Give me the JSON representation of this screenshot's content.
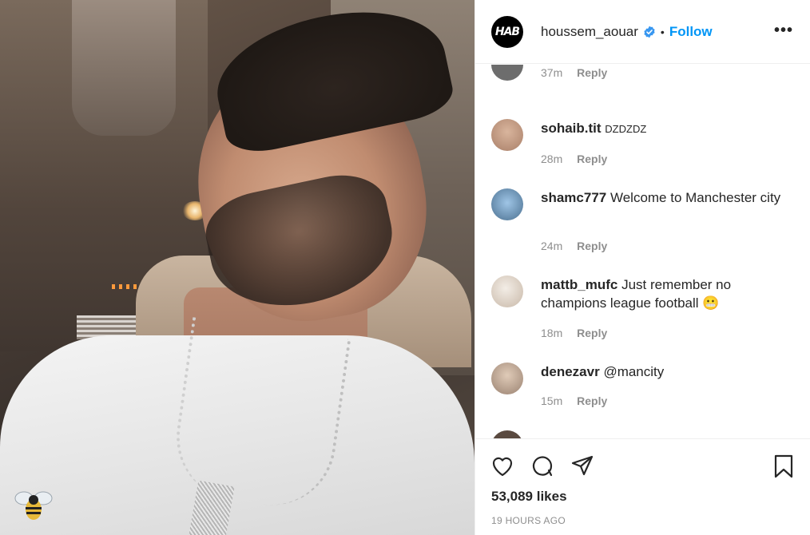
{
  "post": {
    "author": {
      "username": "houssem_aouar",
      "avatar_logo_text": "HAB",
      "verified": true,
      "separator": "•",
      "follow_label": "Follow",
      "more_label": "•••"
    },
    "likes_text": "53,089 likes",
    "time_ago": "19 HOURS AGO"
  },
  "comments": [
    {
      "username": "",
      "text": "",
      "time": "37m",
      "reply_label": "Reply",
      "avatar_color": "#6d6d6d"
    },
    {
      "username": "sohaib.tit",
      "text": "DZDZDZ",
      "time": "28m",
      "reply_label": "Reply",
      "avatar_color": "#c7a28a"
    },
    {
      "username": "shamc777",
      "text": "Welcome to Manchester city",
      "time": "24m",
      "reply_label": "Reply",
      "avatar_color": "#8fb6d9"
    },
    {
      "username": "mattb_mufc",
      "text": "Just remember no champions league football 😬",
      "time": "18m",
      "reply_label": "Reply",
      "avatar_color": "#e9e0d6"
    },
    {
      "username": "denezavr",
      "text": "@mancity",
      "time": "15m",
      "reply_label": "Reply",
      "avatar_color": "#d6c1ae"
    }
  ],
  "icons": {
    "like": "heart-icon",
    "comment": "comment-icon",
    "share": "share-icon",
    "save": "bookmark-icon",
    "verified": "verified-badge-icon",
    "more": "more-options-icon"
  },
  "colors": {
    "follow_blue": "#0095f6",
    "verified_blue": "#3897f0",
    "text": "#262626",
    "muted": "#8e8e8e",
    "border": "#efefef"
  }
}
